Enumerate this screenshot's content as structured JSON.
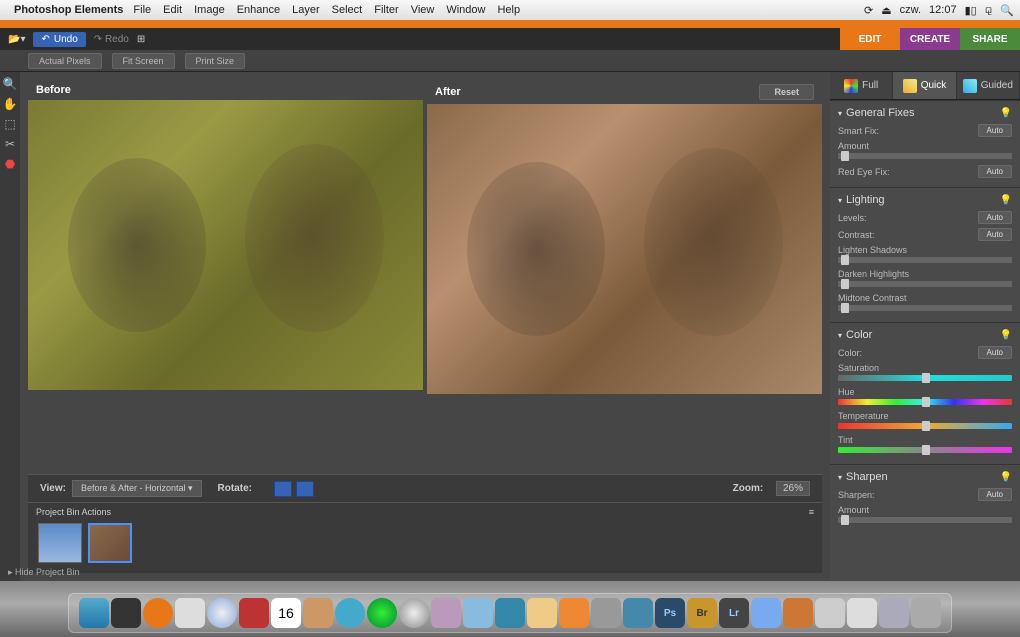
{
  "menubar": {
    "app_name": "Photoshop Elements",
    "items": [
      "File",
      "Edit",
      "Image",
      "Enhance",
      "Layer",
      "Select",
      "Filter",
      "View",
      "Window",
      "Help"
    ],
    "clock_day": "czw.",
    "clock_time": "12:07"
  },
  "top": {
    "undo": "Undo",
    "redo": "Redo",
    "tabs": {
      "edit": "EDIT",
      "create": "CREATE",
      "share": "SHARE"
    }
  },
  "options": {
    "actual_pixels": "Actual Pixels",
    "fit_screen": "Fit Screen",
    "print_size": "Print Size"
  },
  "compare": {
    "before": "Before",
    "after": "After",
    "reset": "Reset"
  },
  "viewbar": {
    "view_label": "View:",
    "view_mode": "Before & After - Horizontal",
    "rotate_label": "Rotate:",
    "zoom_label": "Zoom:",
    "zoom_value": "26%"
  },
  "project_bin": {
    "title": "Project Bin Actions"
  },
  "status": {
    "hide_bin": "Hide Project Bin"
  },
  "modes": {
    "full": "Full",
    "quick": "Quick",
    "guided": "Guided"
  },
  "panels": {
    "general": {
      "title": "General Fixes",
      "smart_fix": "Smart Fix:",
      "amount": "Amount",
      "red_eye": "Red Eye Fix:",
      "auto": "Auto"
    },
    "lighting": {
      "title": "Lighting",
      "levels": "Levels:",
      "contrast": "Contrast:",
      "lighten": "Lighten Shadows",
      "darken": "Darken Highlights",
      "midtone": "Midtone Contrast",
      "auto": "Auto"
    },
    "color": {
      "title": "Color",
      "color": "Color:",
      "saturation": "Saturation",
      "hue": "Hue",
      "temperature": "Temperature",
      "tint": "Tint",
      "auto": "Auto"
    },
    "sharpen": {
      "title": "Sharpen",
      "sharpen": "Sharpen:",
      "amount": "Amount",
      "auto": "Auto"
    }
  },
  "dock": {
    "ps": "Ps",
    "br": "Br",
    "lr": "Lr",
    "cal": "16"
  }
}
